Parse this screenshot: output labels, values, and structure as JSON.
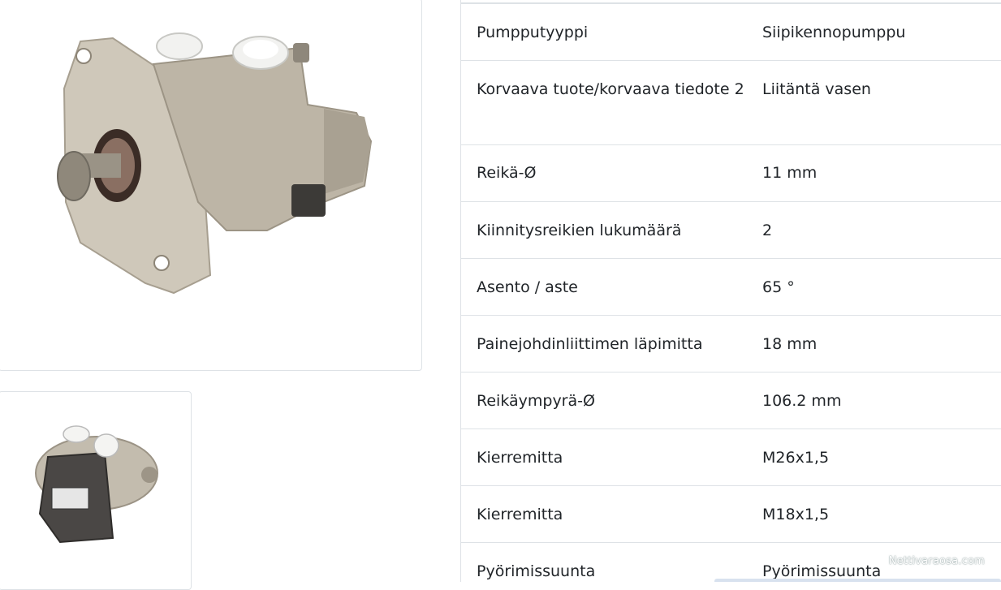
{
  "images": {
    "main_alt": "",
    "thumb_alt": ""
  },
  "specs": [
    {
      "label": "Pumpputyyppi",
      "value": "Siipikennopumppu"
    },
    {
      "label": "Korvaava tuote/korvaava tiedote 2",
      "value": "Liitäntä vasen"
    },
    {
      "label": "Reikä-Ø",
      "value": "11 mm"
    },
    {
      "label": "Kiinnitysreikien lukumäärä",
      "value": "2"
    },
    {
      "label": "Asento / aste",
      "value": "65 °"
    },
    {
      "label": "Painejohdinliittimen läpimitta",
      "value": "18 mm"
    },
    {
      "label": "Reikäympyrä-Ø",
      "value": "106.2 mm"
    },
    {
      "label": "Kierremitta",
      "value": "M26x1,5"
    },
    {
      "label": "Kierremitta",
      "value": "M18x1,5"
    },
    {
      "label": "Pyörimissuunta",
      "value": "Pyörimissuunta"
    }
  ],
  "watermark": "Nettivaraosa.com",
  "colors": {
    "border": "#dee2e6",
    "text": "#212529",
    "metal": "#c9c1b3"
  }
}
